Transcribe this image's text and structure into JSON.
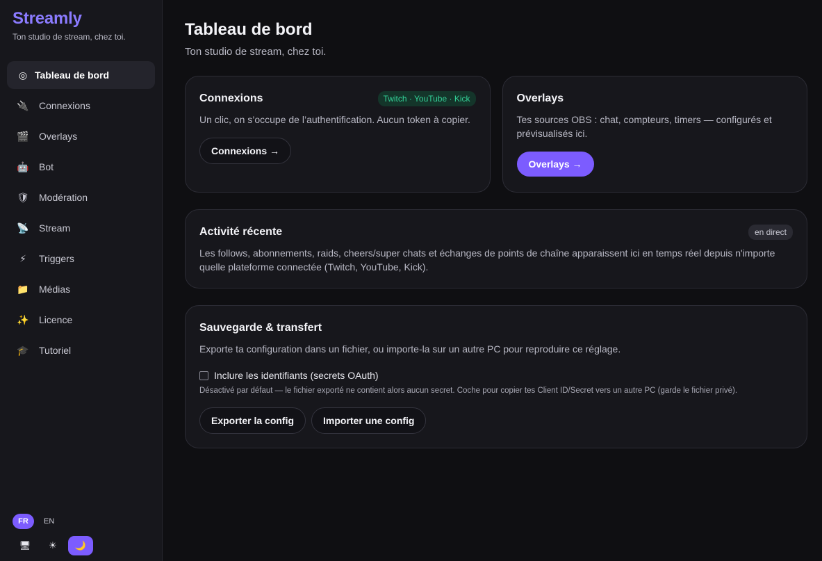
{
  "brand": {
    "name": "Streamly",
    "tagline": "Ton studio de stream, chez toi."
  },
  "nav": [
    {
      "label": "Tableau de bord",
      "icon": "target-icon",
      "glyph": "◎",
      "active": true
    },
    {
      "label": "Connexions",
      "icon": "plug-icon",
      "glyph": "🔌"
    },
    {
      "label": "Overlays",
      "icon": "clapper-icon",
      "glyph": "🎬"
    },
    {
      "label": "Bot",
      "icon": "robot-icon",
      "glyph": "🤖"
    },
    {
      "label": "Modération",
      "icon": "shield-icon",
      "glyph": "🛡"
    },
    {
      "label": "Stream",
      "icon": "stream-icon",
      "glyph": "📡"
    },
    {
      "label": "Triggers",
      "icon": "lightning-icon",
      "glyph": "⚡"
    },
    {
      "label": "Médias",
      "icon": "folder-icon",
      "glyph": "📁"
    },
    {
      "label": "Licence",
      "icon": "sparkles-icon",
      "glyph": "✨"
    },
    {
      "label": "Tutoriel",
      "icon": "graduation-cap-icon",
      "glyph": "🎓"
    }
  ],
  "footer": {
    "lang_active": "FR",
    "lang_other": "EN",
    "themes": [
      {
        "icon": "monitor-icon",
        "glyph": "🖥"
      },
      {
        "icon": "sun-icon",
        "glyph": "☀"
      },
      {
        "icon": "moon-icon",
        "glyph": "🌙",
        "active": true
      }
    ]
  },
  "main": {
    "title": "Tableau de bord",
    "subtitle": "Ton studio de stream, chez toi."
  },
  "cards": {
    "connexions": {
      "title": "Connexions",
      "badge": "Twitch · YouTube · Kick",
      "text": "Un clic, on s’occupe de l’authentification. Aucun token à copier.",
      "button": "Connexions →"
    },
    "overlays": {
      "title": "Overlays",
      "text": "Tes sources OBS : chat, compteurs, timers — configurés et prévisualisés ici.",
      "button": "Overlays →"
    },
    "activity": {
      "title": "Activité récente",
      "badge": "en direct",
      "text": "Les follows, abonnements, raids, cheers/super chats et échanges de points de chaîne apparaissent ici en temps réel depuis n'importe quelle plateforme connectée (Twitch, YouTube, Kick)."
    },
    "backup": {
      "title": "Sauvegarde & transfert",
      "text": "Exporte ta configuration dans un fichier, ou importe-la sur un autre PC pour reproduire ce réglage.",
      "checkbox_label": "Inclure les identifiants (secrets OAuth)",
      "checkbox_checked": false,
      "note": "Désactivé par défaut — le fichier exporté ne contient alors aucun secret. Coche pour copier tes Client ID/Secret vers un autre PC (garde le fichier privé).",
      "export_button": "Exporter la config",
      "import_button": "Importer une config"
    }
  },
  "colors": {
    "accent": "#7c5cff",
    "brand": "#8b7bff",
    "live_green": "#34d399"
  }
}
